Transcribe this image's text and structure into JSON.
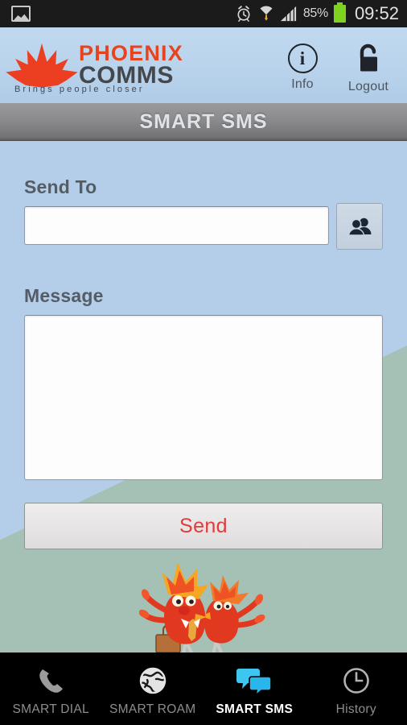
{
  "statusbar": {
    "photo_icon": "photo-icon",
    "alarm_icon": "alarm-clock-icon",
    "wifi_icon": "wifi-download-icon",
    "signal_icon": "signal-bars-icon",
    "battery_percent": "85%",
    "battery_icon": "battery-icon",
    "time": "09:52"
  },
  "header": {
    "logo_icon": "phoenix-flame-logo",
    "brand_line1": "PHOENIX",
    "brand_line2": "COMMS",
    "tagline": "Brings  people  closer",
    "brand_color": "#e8431f",
    "info": {
      "icon": "info-icon",
      "label": "Info"
    },
    "logout": {
      "icon": "open-padlock-icon",
      "label": "Logout"
    }
  },
  "titlebar": {
    "title": "SMART SMS"
  },
  "form": {
    "send_to": {
      "label": "Send To",
      "value": "",
      "placeholder": ""
    },
    "contacts_button": {
      "icon": "contacts-people-icon"
    },
    "message": {
      "label": "Message",
      "value": "",
      "placeholder": ""
    },
    "send_button": {
      "label": "Send",
      "color": "#e23b3b"
    }
  },
  "mascot": {
    "icon": "phoenix-birds-mascot"
  },
  "background": {
    "top_color": "#b4cde8",
    "bottom_color": "#a5c0b4"
  },
  "tabs": [
    {
      "label": "SMART DIAL",
      "icon": "phone-handset-icon",
      "active": false
    },
    {
      "label": "SMART ROAM",
      "icon": "globe-icon",
      "active": false
    },
    {
      "label": "SMART SMS",
      "icon": "speech-bubbles-icon",
      "active": true
    },
    {
      "label": "History",
      "icon": "clock-icon",
      "active": false
    }
  ]
}
